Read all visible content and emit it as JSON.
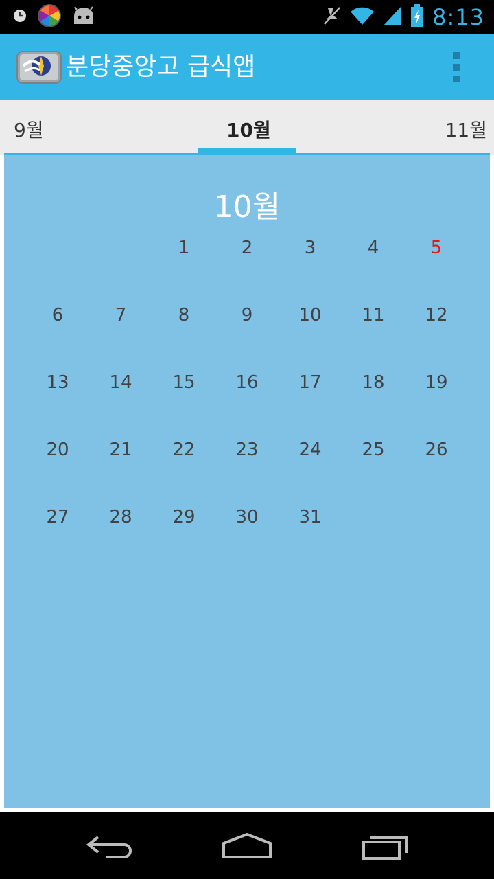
{
  "status_bar": {
    "time": "8:13",
    "left_icons": [
      "clock-icon",
      "color-wheel-icon",
      "android-icon"
    ],
    "right_icons": [
      "mute-icon",
      "wifi-icon",
      "signal-icon",
      "battery-charging-icon"
    ]
  },
  "action_bar": {
    "title": "분당중앙고 급식앱",
    "accent_color": "#33b5e5"
  },
  "tabs": {
    "prev": "9월",
    "current": "10월",
    "next": "11월"
  },
  "calendar": {
    "month_title": "10월",
    "weeks": [
      [
        "",
        "",
        "1",
        "2",
        "3",
        "4",
        "5"
      ],
      [
        "6",
        "7",
        "8",
        "9",
        "10",
        "11",
        "12"
      ],
      [
        "13",
        "14",
        "15",
        "16",
        "17",
        "18",
        "19"
      ],
      [
        "20",
        "21",
        "22",
        "23",
        "24",
        "25",
        "26"
      ],
      [
        "27",
        "28",
        "29",
        "30",
        "31",
        "",
        ""
      ]
    ],
    "highlighted_day": "5",
    "highlight_color": "#e01a1a",
    "background_color": "#80c1e6"
  },
  "nav_bar": {
    "icons": [
      "back-icon",
      "home-icon",
      "recent-apps-icon"
    ]
  }
}
